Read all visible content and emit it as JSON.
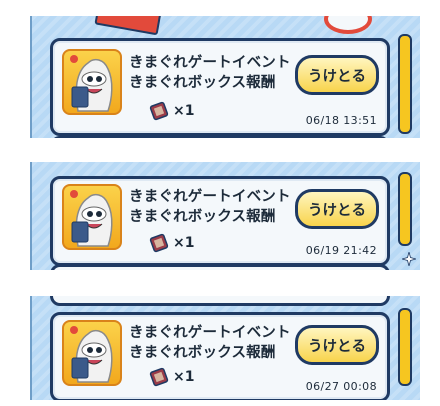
{
  "entries": [
    {
      "title_line1": "きまぐれゲートイベント",
      "title_line2": "きまぐれボックス報酬",
      "reward_count": "×1",
      "button_label": "うけとる",
      "timestamp": "06/18 13:51"
    },
    {
      "title_line1": "きまぐれゲートイベント",
      "title_line2": "きまぐれボックス報酬",
      "reward_count": "×1",
      "button_label": "うけとる",
      "timestamp": "06/19 21:42"
    },
    {
      "title_line1": "きまぐれゲートイベント",
      "title_line2": "きまぐれボックス報酬",
      "reward_count": "×1",
      "button_label": "うけとる",
      "timestamp": "06/27 00:08"
    }
  ],
  "icons": {
    "avatar": "whisper-ghost-avatar-icon",
    "reward_item": "reward-box-item-icon"
  },
  "colors": {
    "panel_bg": "#b8d9f5",
    "card_border": "#1f3a63",
    "button_fill": "#f8d44c",
    "scrollbar": "#f6c620",
    "avatar_bg": "#fbd24a"
  }
}
